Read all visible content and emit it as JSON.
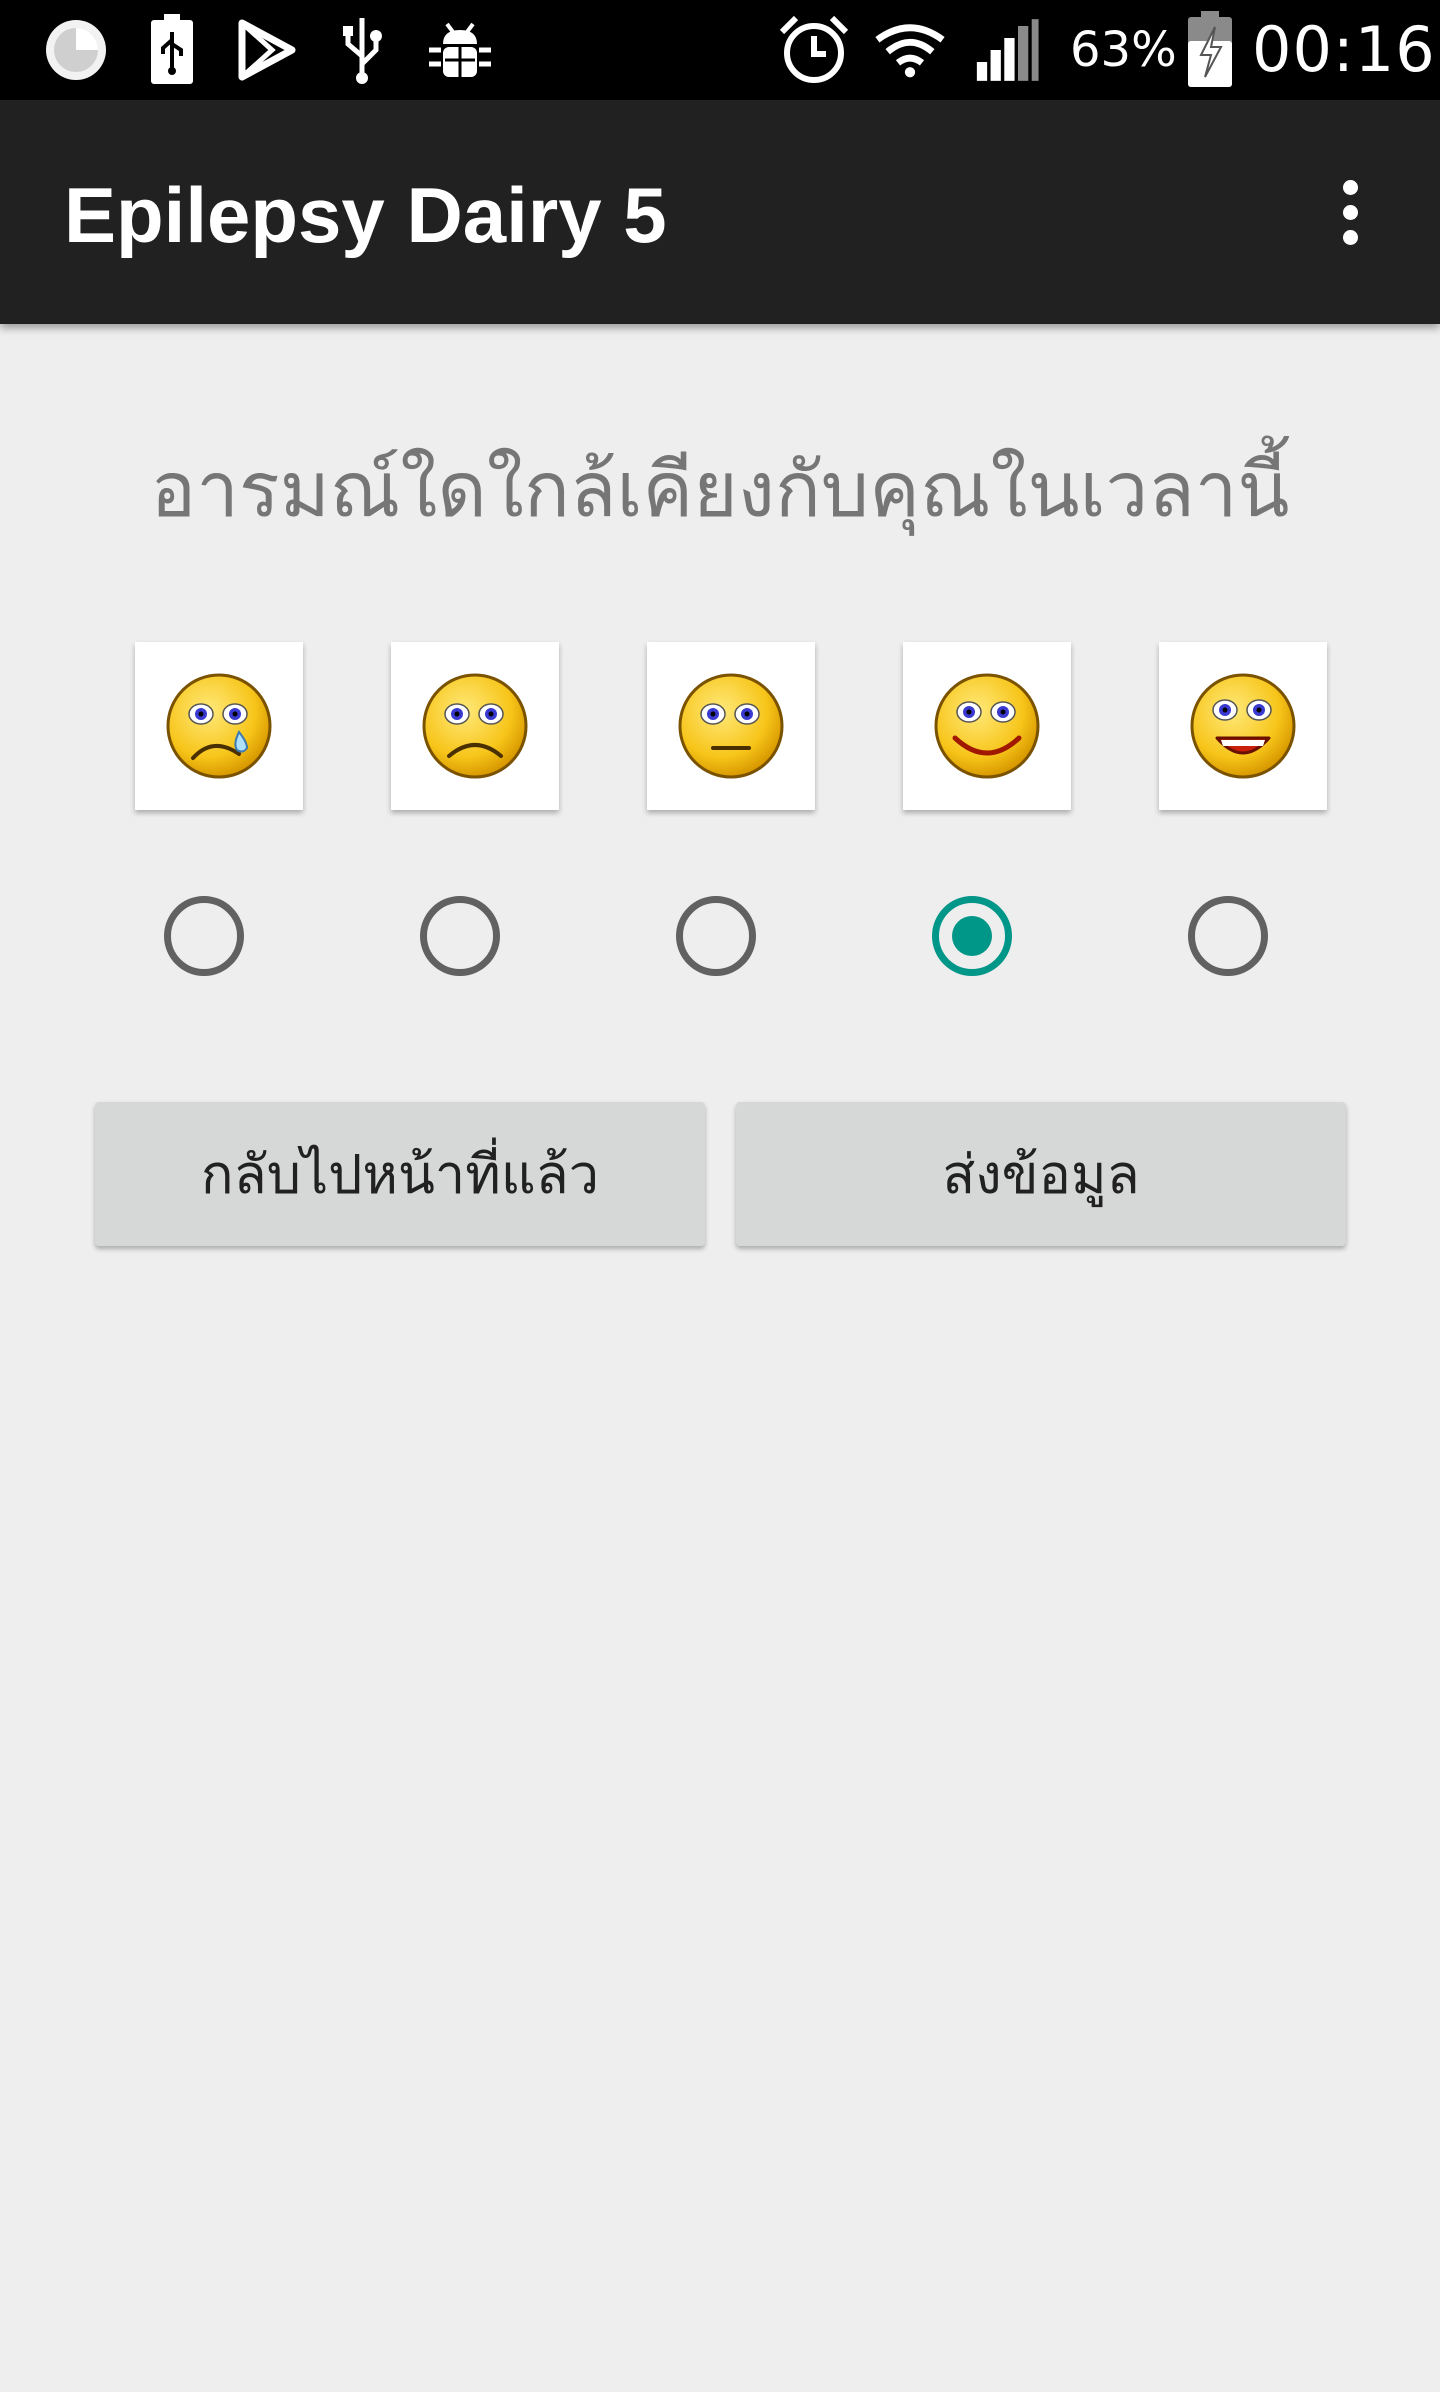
{
  "status_bar": {
    "battery_percent": "63%",
    "clock": "00:16",
    "left_icons": [
      "circle-app-icon",
      "battery-usb-icon",
      "play-store-icon",
      "usb-icon",
      "android-debug-icon"
    ],
    "right_icons": [
      "alarm-icon",
      "wifi-icon",
      "signal-icon",
      "battery-charging-icon"
    ]
  },
  "app_bar": {
    "title": "Epilepsy Dairy 5",
    "menu_icon": "overflow-menu-icon"
  },
  "question": "อารมณ์ใดใกล้เคียงกับคุณในเวลานี้",
  "moods": [
    {
      "icon": "crying-face-icon"
    },
    {
      "icon": "sad-face-icon"
    },
    {
      "icon": "neutral-face-icon"
    },
    {
      "icon": "smiling-face-icon"
    },
    {
      "icon": "laughing-face-icon"
    }
  ],
  "selected_mood_index": 3,
  "buttons": {
    "back_label": "กลับไปหน้าที่แล้ว",
    "send_label": "ส่งข้อมูล"
  },
  "colors": {
    "accent": "#009688",
    "app_bar": "#212121",
    "background": "#eeeeee",
    "button": "#d6d7d7",
    "question_text": "#767676"
  }
}
